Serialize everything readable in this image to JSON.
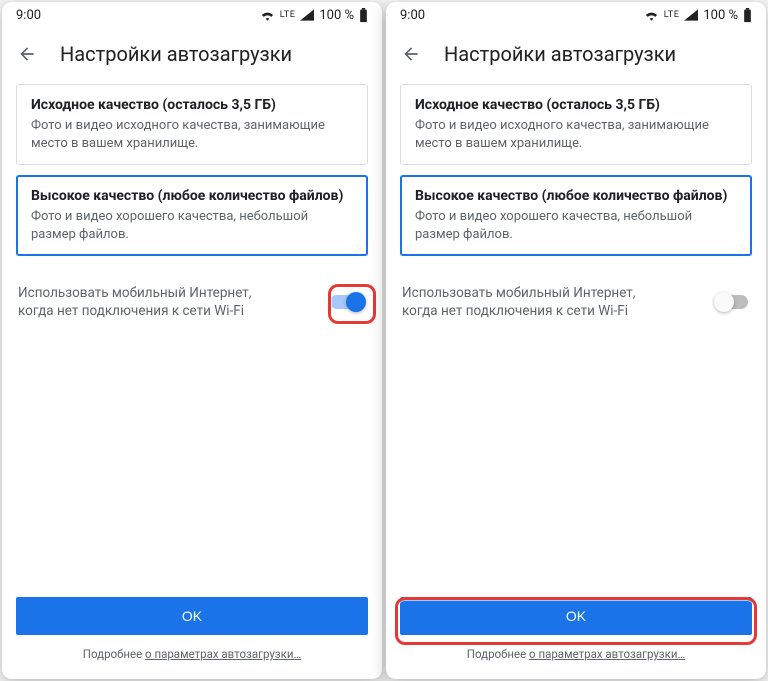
{
  "status": {
    "time": "9:00",
    "lte": "LTE",
    "battery": "100 %"
  },
  "header": {
    "title": "Настройки автозагрузки"
  },
  "options": {
    "original": {
      "title": "Исходное качество (осталось 3,5 ГБ)",
      "sub": "Фото и видео исходного качества, занимающие место в вашем хранилище."
    },
    "high": {
      "title": "Высокое качество (любое количество файлов)",
      "sub": "Фото и видео хорошего качества, небольшой размер файлов."
    }
  },
  "toggle": {
    "label": "Использовать мобильный Интернет, когда нет подключения к сети Wi-Fi"
  },
  "footer": {
    "ok": "OK",
    "learn_prefix": "Подробнее ",
    "learn_link": "о параметрах автозагрузки…"
  },
  "screens": {
    "left": {
      "toggle_on": true,
      "highlight": "toggle"
    },
    "right": {
      "toggle_on": false,
      "highlight": "ok"
    }
  }
}
